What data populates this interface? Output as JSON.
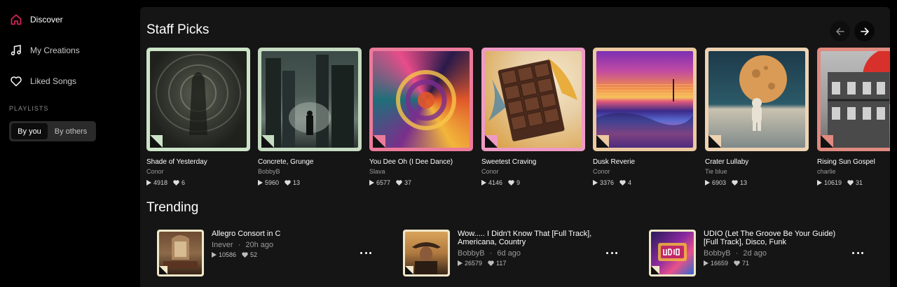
{
  "sidebar": {
    "nav": [
      {
        "label": "Discover",
        "icon": "home-icon",
        "active": true
      },
      {
        "label": "My Creations",
        "icon": "music-note-icon"
      },
      {
        "label": "Liked Songs",
        "icon": "heart-icon"
      }
    ],
    "playlists_heading": "PLAYLISTS",
    "playlist_tabs": [
      "By you",
      "By others"
    ]
  },
  "staff_picks": {
    "title": "Staff Picks",
    "cards": [
      {
        "title": "Shade of Yesterday",
        "artist": "Conor",
        "plays": "4918",
        "likes": "6",
        "border": "#cde4c8"
      },
      {
        "title": "Concrete, Grunge",
        "artist": "BobbyB",
        "plays": "5960",
        "likes": "13",
        "border": "#c6dcc2"
      },
      {
        "title": "You Dee Oh (I Dee Dance)",
        "artist": "Slava",
        "plays": "6577",
        "likes": "37",
        "border": "#ec7a9a"
      },
      {
        "title": "Sweetest Craving",
        "artist": "Conor",
        "plays": "4146",
        "likes": "9",
        "border": "#ef9ac4"
      },
      {
        "title": "Dusk Reverie",
        "artist": "Conor",
        "plays": "3376",
        "likes": "4",
        "border": "#ecc9a0"
      },
      {
        "title": "Crater Lullaby",
        "artist": "Tie blue",
        "plays": "6903",
        "likes": "13",
        "border": "#eed3b3"
      },
      {
        "title": "Rising Sun Gospel",
        "artist": "charlie",
        "plays": "10619",
        "likes": "31",
        "border": "#e08a80"
      }
    ]
  },
  "trending": {
    "title": "Trending",
    "items": [
      {
        "title": "Allegro Consort in C",
        "artist": "Inever",
        "age": "20h ago",
        "plays": "10586",
        "likes": "52"
      },
      {
        "title": "Wow..... I Didn't Know That [Full Track], Americana, Country",
        "artist": "BobbyB",
        "age": "6d ago",
        "plays": "26579",
        "likes": "117"
      },
      {
        "title": "UDIO (Let The Groove Be Your Guide) [Full Track], Disco, Funk",
        "artist": "BobbyB",
        "age": "2d ago",
        "plays": "16659",
        "likes": "71"
      }
    ]
  },
  "colors": {
    "accent": "#e6265c",
    "background": "#000000",
    "panel": "#151515"
  }
}
